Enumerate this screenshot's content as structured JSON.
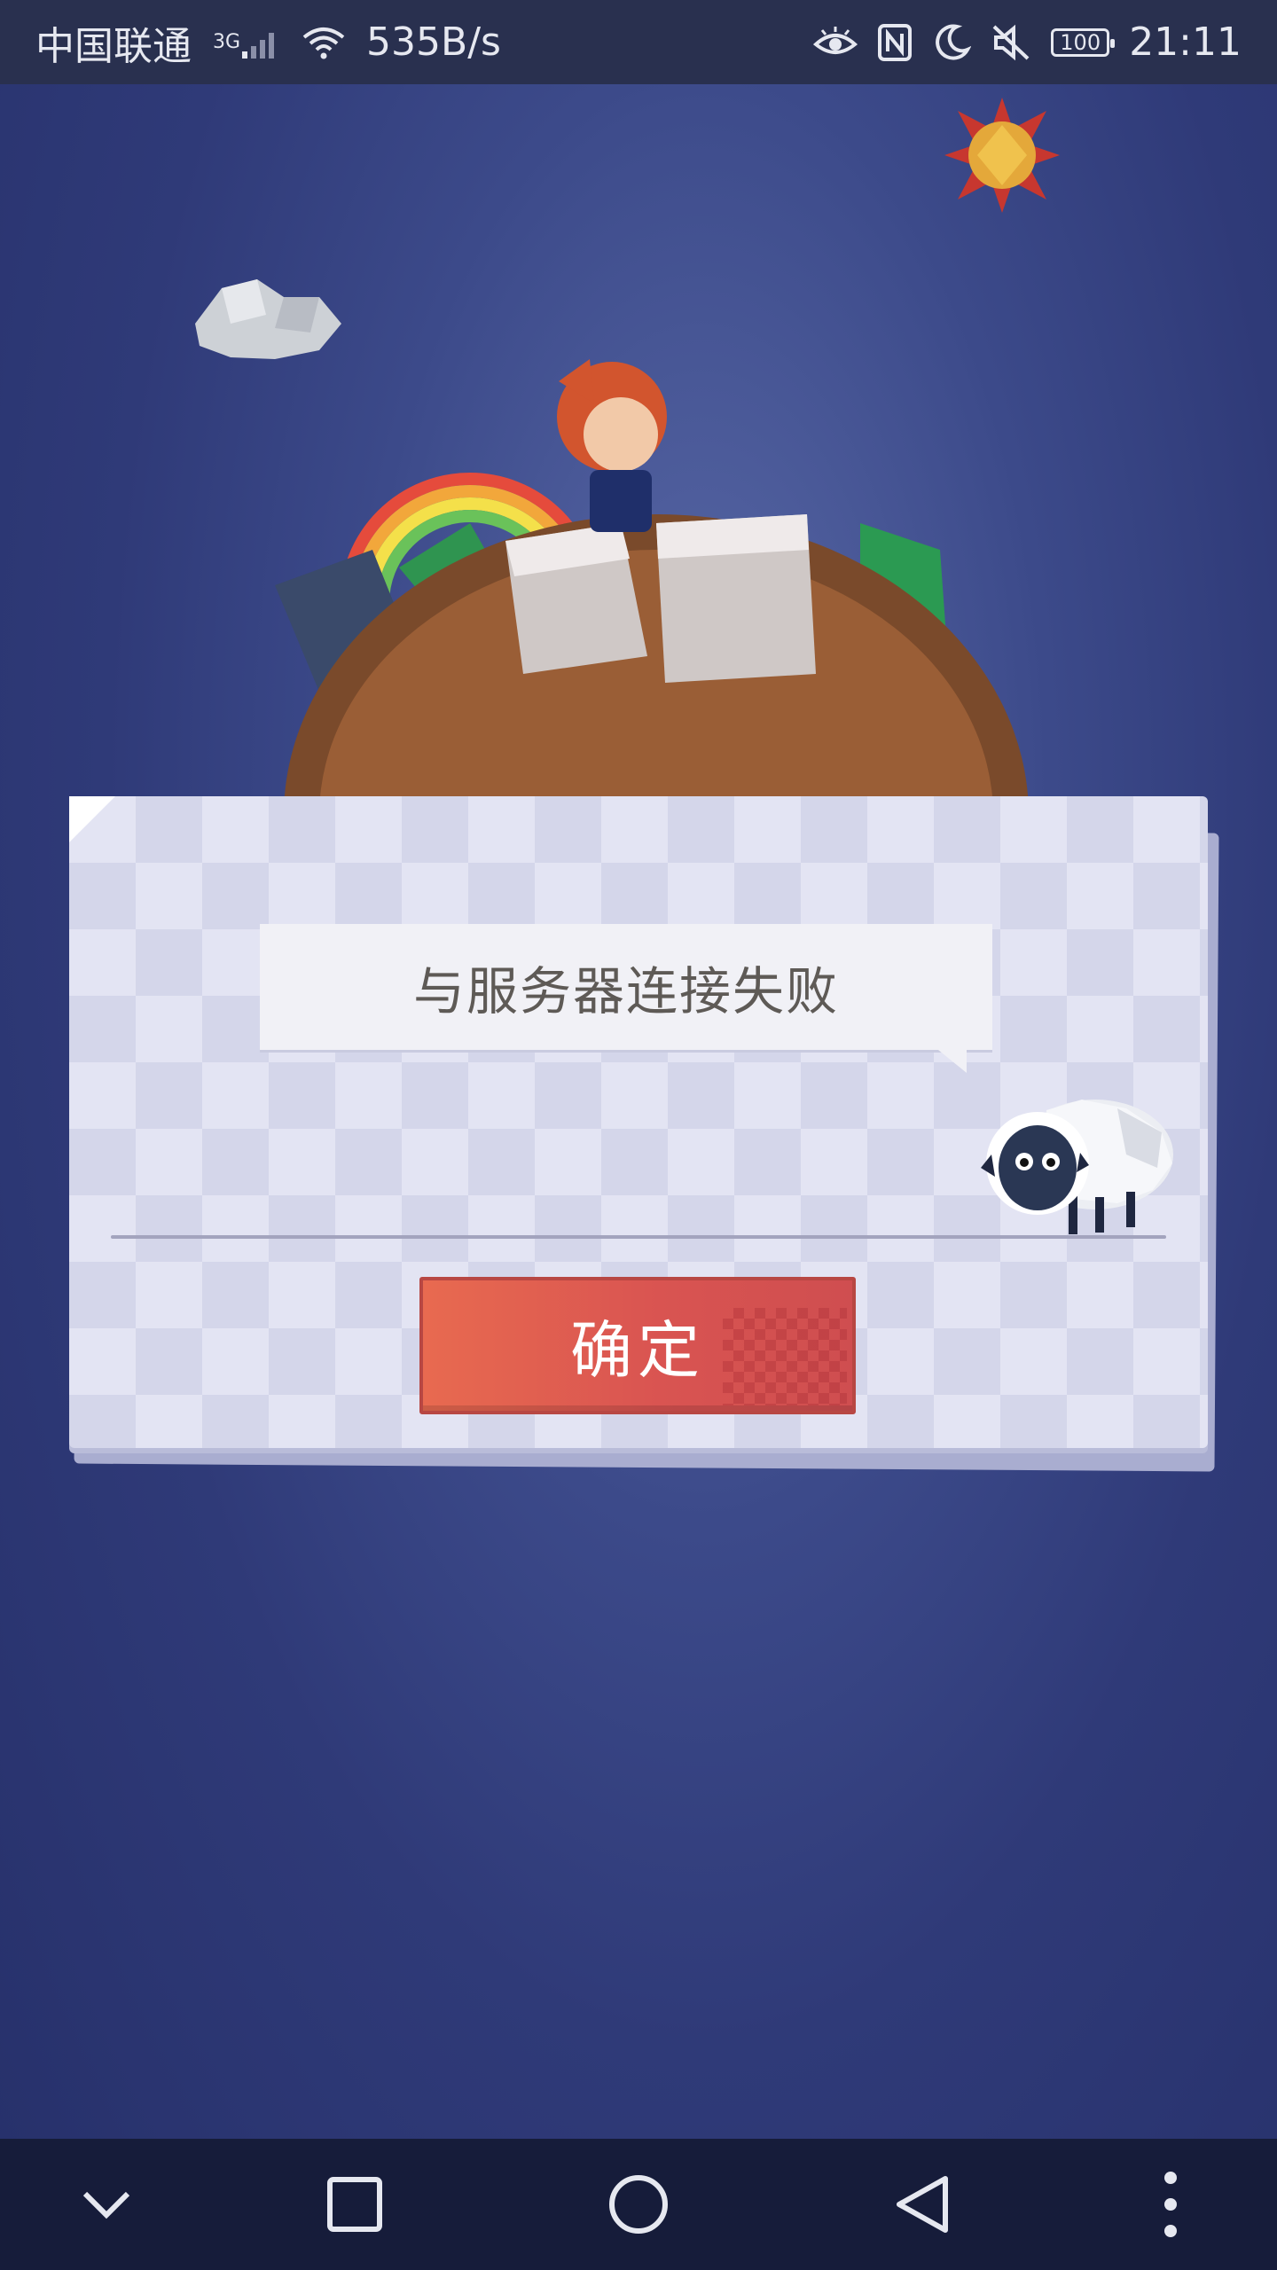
{
  "status_bar": {
    "carrier": "中国联通",
    "network_type": "3G",
    "net_speed": "535B/s",
    "battery": "100",
    "time": "21:11",
    "icons": [
      "signal-icon",
      "wifi-icon",
      "eye-icon",
      "nfc-icon",
      "moon-icon",
      "mute-icon",
      "battery-icon"
    ]
  },
  "dialog": {
    "message": "与服务器连接失败",
    "confirm_label": "确定"
  },
  "nav_bar": {
    "icons": [
      "chevron-down-icon",
      "square-icon",
      "circle-home-icon",
      "triangle-back-icon",
      "more-vertical-icon"
    ]
  },
  "colors": {
    "button": "#d95451",
    "background": "#3c4a8a",
    "dialog": "#e3e4f3",
    "statusbar": "#29304f",
    "navbar": "#161c3a"
  }
}
